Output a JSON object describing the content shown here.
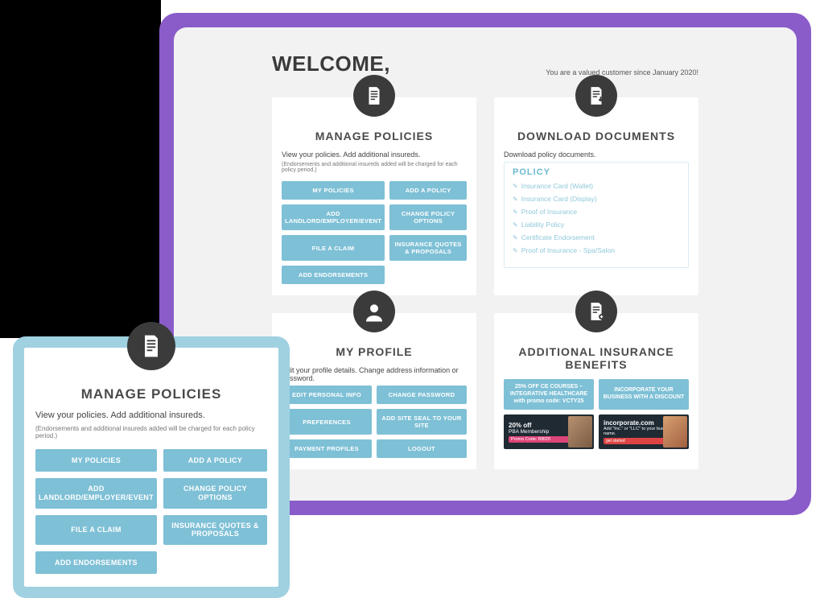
{
  "welcome": {
    "title": "WELCOME,",
    "since_text": "You are a valued customer since January 2020!"
  },
  "manage_policies": {
    "title": "MANAGE POLICIES",
    "desc": "View your policies. Add additional insureds.",
    "note": "(Endorsements and additional insureds added will be charged for each policy period.)",
    "buttons": {
      "my_policies": "MY POLICIES",
      "add_policy": "ADD A POLICY",
      "add_landlord": "ADD LANDLORD/EMPLOYER/EVENT",
      "change_options": "CHANGE POLICY OPTIONS",
      "file_claim": "FILE A CLAIM",
      "quotes": "INSURANCE QUOTES & PROPOSALS",
      "add_endorsements": "ADD ENDORSEMENTS"
    }
  },
  "download_documents": {
    "title": "DOWNLOAD DOCUMENTS",
    "desc": "Download policy documents.",
    "section_head": "POLICY",
    "links": {
      "card_wallet": "Insurance Card (Wallet)",
      "card_display": "Insurance Card (Display)",
      "proof": "Proof of Insurance",
      "liability": "Liability Policy",
      "cert_endorsement": "Certificate Endorsement",
      "proof_spa": "Proof of Insurance - Spa/Salon"
    }
  },
  "my_profile": {
    "title": "MY PROFILE",
    "desc": "Edit your profile details. Change address information or password.",
    "buttons": {
      "edit_info": "EDIT PERSONAL INFO",
      "change_pw": "CHANGE PASSWORD",
      "preferences": "PREFERENCES",
      "site_seal": "ADD SITE SEAL TO YOUR SITE",
      "payment": "PAYMENT PROFILES",
      "logout": "LOGOUT"
    }
  },
  "benefits": {
    "title": "ADDITIONAL INSURANCE BENEFITS",
    "btn1": "25% OFF CE COURSES – INTEGRATIVE HEALTHCARE with promo code: VCTY25",
    "btn2": "INCORPORATE YOUR BUSINESS WITH A DISCOUNT",
    "promo1": {
      "headline": "20% off",
      "sub": "PBA Membership",
      "code_label": "Promo Code: BBI20"
    },
    "promo2": {
      "brand": "incorporate.com",
      "sub": "Add \"Inc.\" or \"LLC\" to your business name.",
      "cta": "get started"
    }
  }
}
